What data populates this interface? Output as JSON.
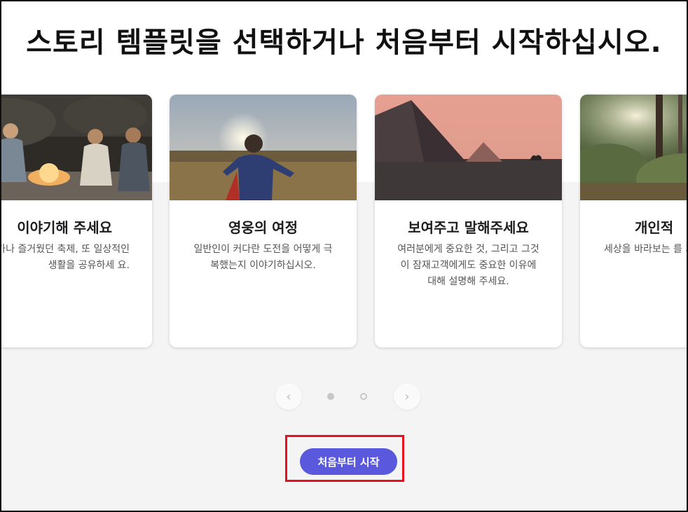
{
  "page": {
    "title": "스토리 템플릿을 선택하거나 처음부터 시작하십시오."
  },
  "cards": [
    {
      "title": "이야기해 주세요",
      "description": "족 휴가나 즐거웠던 축제, 또 일상적인 생활을 공유하세 요.",
      "image": "campfire-photo"
    },
    {
      "title": "영웅의 여정",
      "description": "일반인이 커다란 도전을 어떻게 극복했는지 이야기하십시오.",
      "image": "child-in-wheat-field-photo"
    },
    {
      "title": "보여주고 말해주세요",
      "description": "여러분에게 중요한 것, 그리고 그것이 잠재고객에게도 중요한 이유에 대해 설명해 주세요.",
      "image": "pyramids-photo"
    },
    {
      "title": "개인적 ",
      "description": "세상을 바라보는 를 가져온 경험을 요.",
      "image": "forest-photo"
    }
  ],
  "pager": {
    "prev_icon": "‹",
    "next_icon": "›",
    "dots": [
      "active",
      "inactive"
    ]
  },
  "cta": {
    "label": "처음부터 시작"
  },
  "colors": {
    "accent": "#5a59dd",
    "highlight": "#e8101c"
  }
}
